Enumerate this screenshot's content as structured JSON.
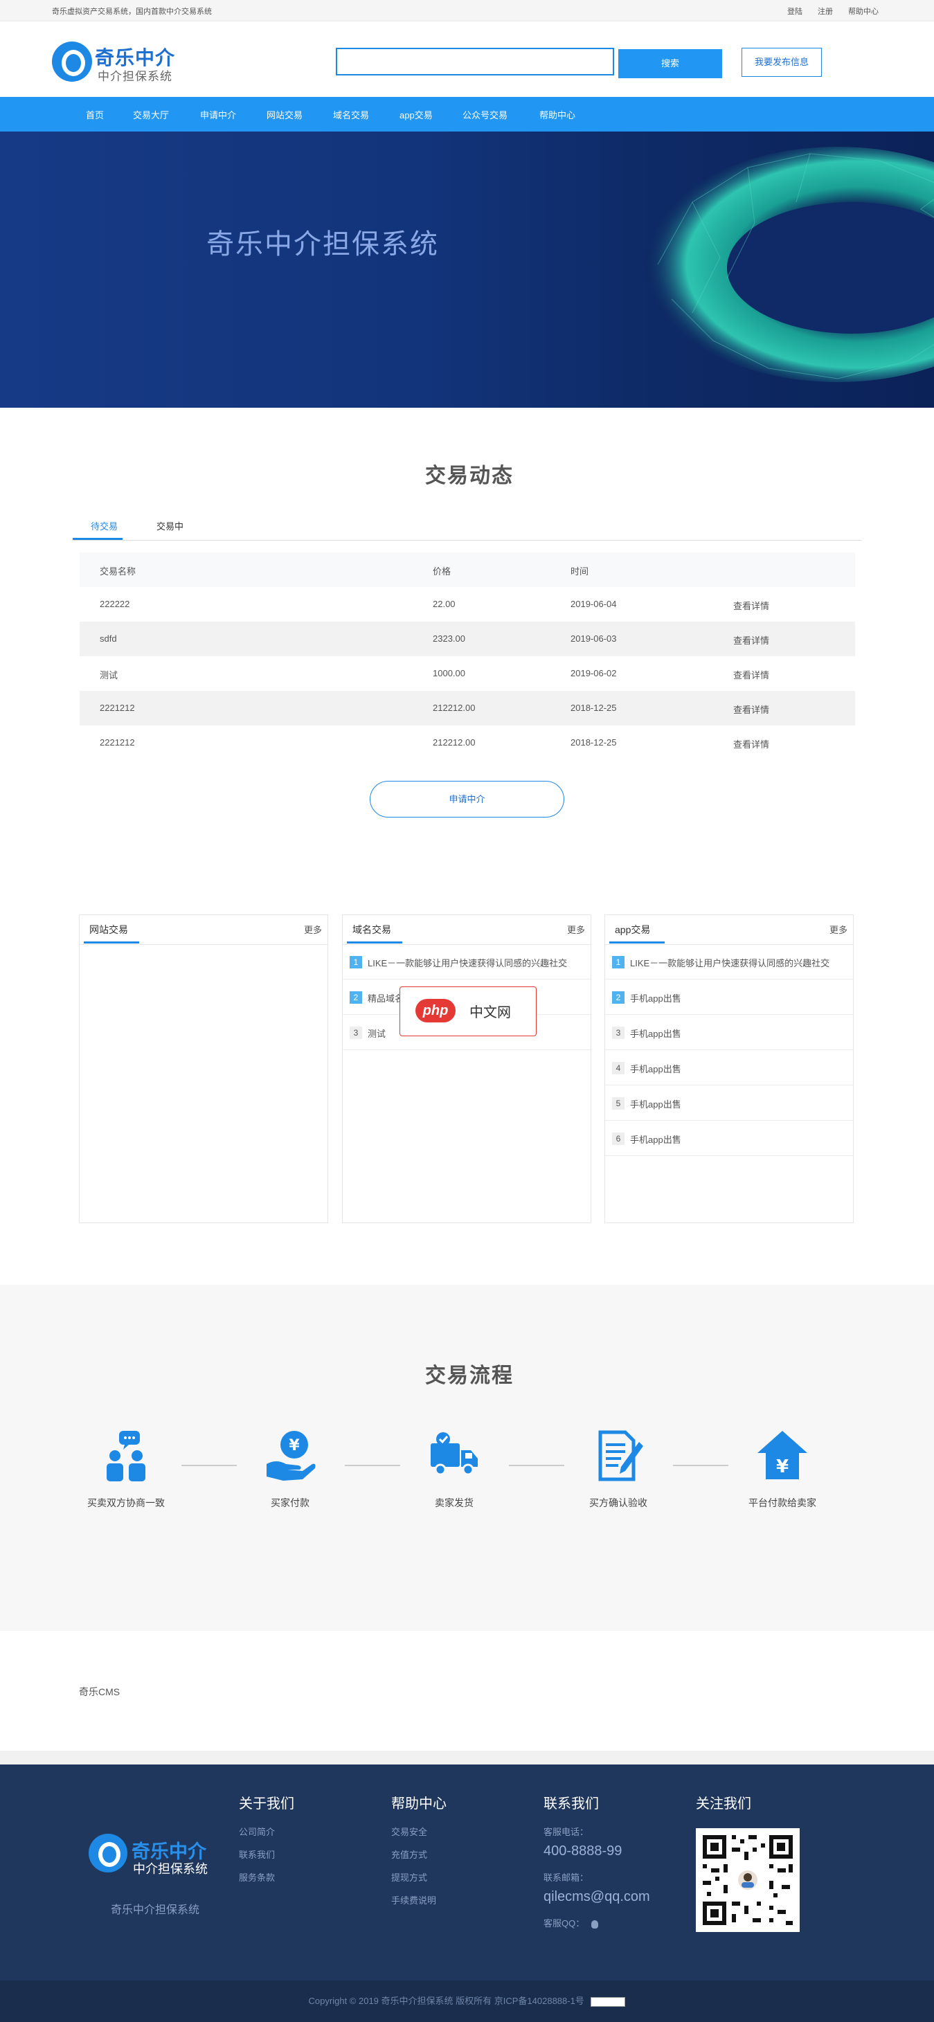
{
  "topbar": {
    "tagline": "奇乐虚拟资产交易系统，国内首款中介交易系统",
    "login": "登陆",
    "register": "注册",
    "help": "帮助中心"
  },
  "logo": {
    "name": "奇乐中介",
    "sub": "中介担保系统"
  },
  "search": {
    "button": "搜索"
  },
  "publish_button": "我要发布信息",
  "nav": [
    "首页",
    "交易大厅",
    "申请中介",
    "网站交易",
    "域名交易",
    "app交易",
    "公众号交易",
    "帮助中心"
  ],
  "banner": {
    "title": "奇乐中介担保系统"
  },
  "trades": {
    "title": "交易动态",
    "tabs": [
      "待交易",
      "交易中"
    ],
    "headers": [
      "交易名称",
      "价格",
      "时间"
    ],
    "rows": [
      {
        "name": "222222",
        "price": "22.00",
        "date": "2019-06-04",
        "action": "查看详情"
      },
      {
        "name": "sdfd",
        "price": "2323.00",
        "date": "2019-06-03",
        "action": "查看详情"
      },
      {
        "name": "测试",
        "price": "1000.00",
        "date": "2019-06-02",
        "action": "查看详情"
      },
      {
        "name": "2221212",
        "price": "212212.00",
        "date": "2018-12-25",
        "action": "查看详情"
      },
      {
        "name": "2221212",
        "price": "212212.00",
        "date": "2018-12-25",
        "action": "查看详情"
      }
    ],
    "apply_button": "申请中介"
  },
  "panels": [
    {
      "title": "网站交易",
      "more": "更多",
      "items": []
    },
    {
      "title": "域名交易",
      "more": "更多",
      "items": [
        "LIKE－一款能够让用户快速获得认同感的兴趣社交",
        "精品域名",
        "测试"
      ]
    },
    {
      "title": "app交易",
      "more": "更多",
      "items": [
        "LIKE－一款能够让用户快速获得认同感的兴趣社交",
        "手机app出售",
        "手机app出售",
        "手机app出售",
        "手机app出售",
        "手机app出售"
      ]
    }
  ],
  "watermark": {
    "logo": "php",
    "text": "中文网"
  },
  "process": {
    "title": "交易流程",
    "steps": [
      "买卖双方协商一致",
      "买家付款",
      "卖家发货",
      "买方确认验收",
      "平台付款给卖家"
    ]
  },
  "cms_link": "奇乐CMS",
  "footer": {
    "logo_name": "奇乐中介",
    "logo_sub": "中介担保系统",
    "slogan": "奇乐中介担保系统",
    "about": {
      "title": "关于我们",
      "links": [
        "公司简介",
        "联系我们",
        "服务条款"
      ]
    },
    "help": {
      "title": "帮助中心",
      "links": [
        "交易安全",
        "充值方式",
        "提现方式",
        "手续费说明"
      ]
    },
    "contact": {
      "title": "联系我们",
      "phone_label": "客服电话：",
      "phone": "400-8888-99",
      "email_label": "联系邮箱：",
      "email": "qilecms@qq.com",
      "qq_label": "客服QQ："
    },
    "follow": {
      "title": "关注我们"
    },
    "copyright": "Copyright © 2019 奇乐中介担保系统 版权所有 京ICP备14028888-1号"
  },
  "colors": {
    "primary": "#2196f3",
    "footer": "#20375d",
    "banner": "#12347a"
  }
}
